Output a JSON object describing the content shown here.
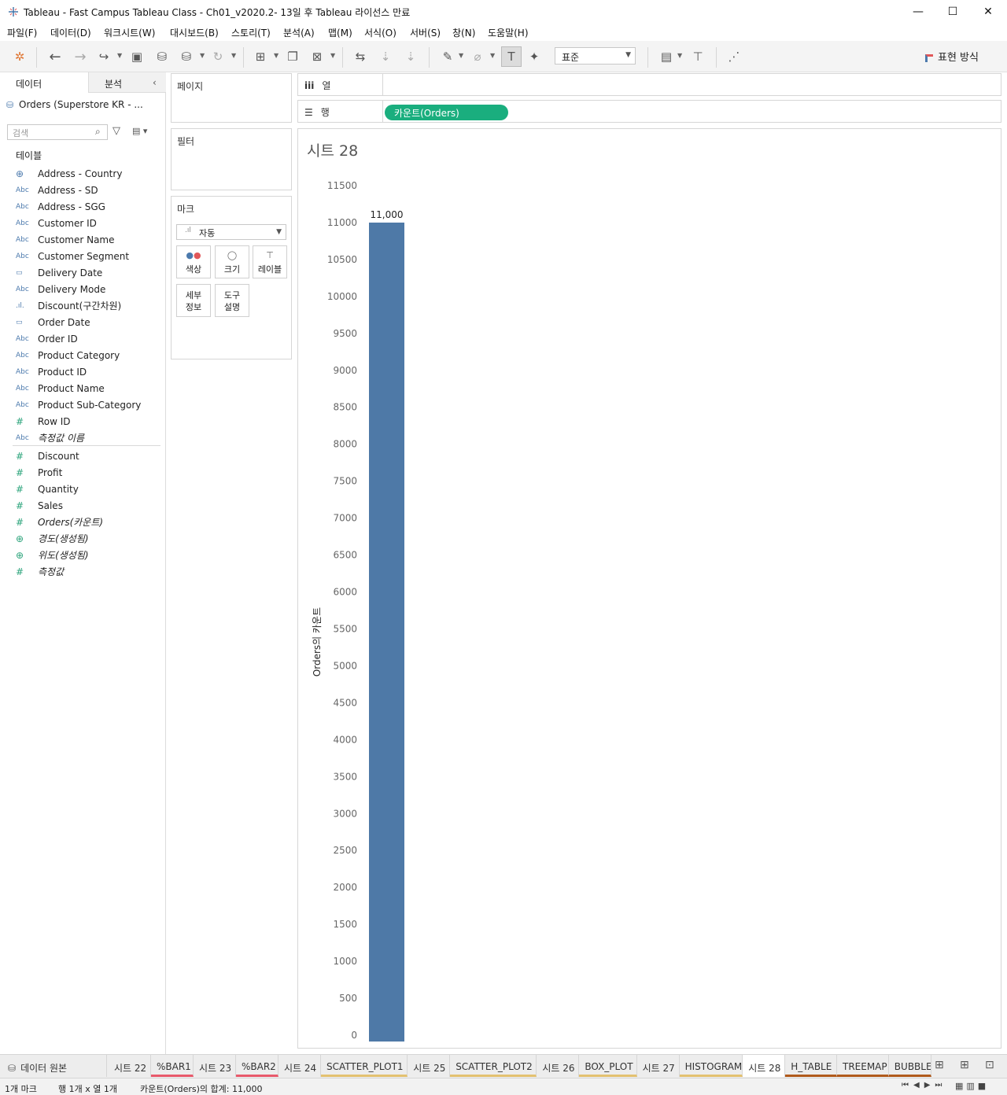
{
  "window": {
    "title": "Tableau - Fast Campus Tableau Class - Ch01_v2020.2- 13일 후 Tableau 라이선스 만료",
    "minimize": "—",
    "maximize": "☐",
    "close": "✕"
  },
  "menu": [
    "파일(F)",
    "데이터(D)",
    "워크시트(W)",
    "대시보드(B)",
    "스토리(T)",
    "분석(A)",
    "맵(M)",
    "서식(O)",
    "서버(S)",
    "창(N)",
    "도움말(H)"
  ],
  "toolbar": {
    "fit_value": "표준",
    "show_me": "표현 방식"
  },
  "left_pane": {
    "tab_data": "데이터",
    "tab_analysis": "분석",
    "datasource": "Orders (Superstore KR - ...",
    "search_placeholder": "검색",
    "tables_label": "테이블",
    "dimensions": [
      {
        "icon": "⊕",
        "name": "Address - Country",
        "italic": false,
        "globe": true
      },
      {
        "icon": "Abc",
        "name": "Address - SD",
        "italic": false
      },
      {
        "icon": "Abc",
        "name": "Address - SGG",
        "italic": false
      },
      {
        "icon": "Abc",
        "name": "Customer ID",
        "italic": false
      },
      {
        "icon": "Abc",
        "name": "Customer Name",
        "italic": false
      },
      {
        "icon": "Abc",
        "name": "Customer Segment",
        "italic": false
      },
      {
        "icon": "▭",
        "name": "Delivery Date",
        "italic": false
      },
      {
        "icon": "Abc",
        "name": "Delivery Mode",
        "italic": false
      },
      {
        "icon": ".ıl.",
        "name": "Discount(구간차원)",
        "italic": false
      },
      {
        "icon": "▭",
        "name": "Order Date",
        "italic": false
      },
      {
        "icon": "Abc",
        "name": "Order ID",
        "italic": false
      },
      {
        "icon": "Abc",
        "name": "Product Category",
        "italic": false
      },
      {
        "icon": "Abc",
        "name": "Product ID",
        "italic": false
      },
      {
        "icon": "Abc",
        "name": "Product Name",
        "italic": false
      },
      {
        "icon": "Abc",
        "name": "Product Sub-Category",
        "italic": false
      },
      {
        "icon": "#",
        "name": "Row ID",
        "italic": false
      },
      {
        "icon": "Abc",
        "name": "측정값 이름",
        "italic": true
      }
    ],
    "measures": [
      {
        "icon": "#",
        "name": "Discount",
        "italic": false
      },
      {
        "icon": "#",
        "name": "Profit",
        "italic": false
      },
      {
        "icon": "#",
        "name": "Quantity",
        "italic": false
      },
      {
        "icon": "#",
        "name": "Sales",
        "italic": false
      },
      {
        "icon": "#",
        "name": "Orders(카운트)",
        "italic": true
      },
      {
        "icon": "⊕",
        "name": "경도(생성됨)",
        "italic": true
      },
      {
        "icon": "⊕",
        "name": "위도(생성됨)",
        "italic": true
      },
      {
        "icon": "#",
        "name": "측정값",
        "italic": true
      }
    ]
  },
  "cards": {
    "pages": "페이지",
    "filters": "필터",
    "marks": "마크",
    "mark_type": "자동",
    "buttons": {
      "color": "색상",
      "size": "크기",
      "label": "레이블",
      "detail": "세부 정보",
      "tooltip": "도구 설명"
    }
  },
  "shelves": {
    "columns_label": "열",
    "rows_label": "행",
    "rows_pill": "카운트(Orders)"
  },
  "sheet_title": "시트 28",
  "chart_data": {
    "type": "bar",
    "categories": [
      ""
    ],
    "values": [
      11000
    ],
    "data_labels": [
      "11,000"
    ],
    "title": "",
    "xlabel": "",
    "ylabel": "Orders의 카운트",
    "ylim": [
      0,
      11500
    ],
    "yticks": [
      0,
      500,
      1000,
      1500,
      2000,
      2500,
      3000,
      3500,
      4000,
      4500,
      5000,
      5500,
      6000,
      6500,
      7000,
      7500,
      8000,
      8500,
      9000,
      9500,
      10000,
      10500,
      11000,
      11500
    ],
    "bar_color": "#4e79a7",
    "grid": false
  },
  "sheet_tabs": [
    {
      "label": "시트 22",
      "underline": ""
    },
    {
      "label": "%BAR1",
      "underline": "#e8596b"
    },
    {
      "label": "시트 23",
      "underline": ""
    },
    {
      "label": "%BAR2",
      "underline": "#e8596b"
    },
    {
      "label": "시트 24",
      "underline": ""
    },
    {
      "label": "SCATTER_PLOT1",
      "underline": "#e3c170"
    },
    {
      "label": "시트 25",
      "underline": ""
    },
    {
      "label": "SCATTER_PLOT2",
      "underline": "#e3c170"
    },
    {
      "label": "시트 26",
      "underline": ""
    },
    {
      "label": "BOX_PLOT",
      "underline": "#e3c170"
    },
    {
      "label": "시트 27",
      "underline": ""
    },
    {
      "label": "HISTOGRAM",
      "underline": "#e3c170"
    },
    {
      "label": "시트 28",
      "underline": "",
      "active": true
    },
    {
      "label": "H_TABLE",
      "underline": "#b05a1c"
    },
    {
      "label": "TREEMAP",
      "underline": "#b05a1c"
    },
    {
      "label": "BUBBLE",
      "underline": "#b05a1c"
    }
  ],
  "datasource_tab": "데이터 원본",
  "status": {
    "marks": "1개 마크",
    "rows_cols": "행 1개 x 열 1개",
    "sum": "카운트(Orders)의 합계: 11,000"
  },
  "colors": {
    "pill_green": "#1aae7e",
    "accent_blue": "#4c7aad"
  }
}
